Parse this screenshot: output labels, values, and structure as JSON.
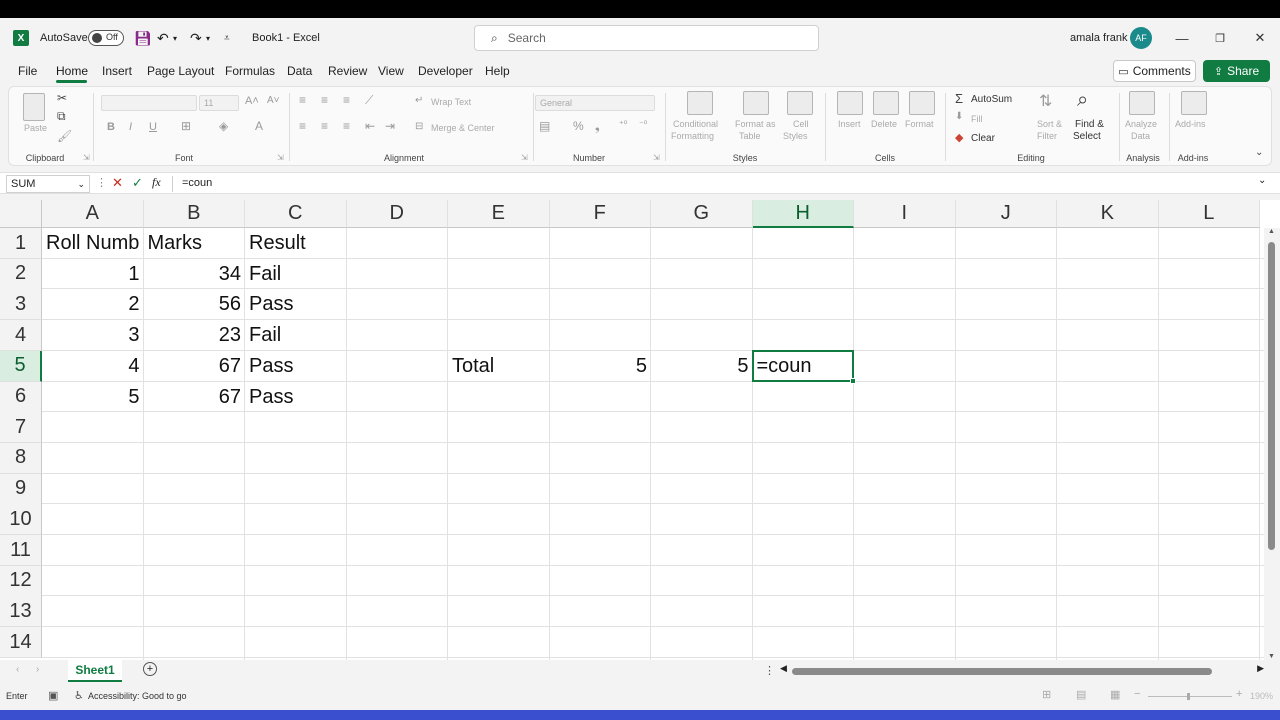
{
  "titlebar": {
    "autosave_label": "AutoSave",
    "autosave_state": "Off",
    "doc_title": "Book1  -  Excel",
    "search_placeholder": "Search",
    "user_name": "amala frank",
    "user_initials": "AF"
  },
  "menu": {
    "tabs": [
      "File",
      "Home",
      "Insert",
      "Page Layout",
      "Formulas",
      "Data",
      "Review",
      "View",
      "Developer",
      "Help"
    ],
    "active_tab": "Home",
    "comments_label": "Comments",
    "share_label": "Share"
  },
  "ribbon": {
    "clipboard": {
      "paste": "Paste",
      "label": "Clipboard"
    },
    "font": {
      "size": "11",
      "bold": "B",
      "italic": "I",
      "underline": "U",
      "label": "Font"
    },
    "alignment": {
      "wrap": "Wrap Text",
      "merge": "Merge & Center",
      "label": "Alignment"
    },
    "number": {
      "format": "General",
      "label": "Number"
    },
    "styles": {
      "cond1": "Conditional",
      "cond2": "Formatting",
      "fmt1": "Format as",
      "fmt2": "Table",
      "cell1": "Cell",
      "cell2": "Styles",
      "label": "Styles"
    },
    "cells": {
      "insert": "Insert",
      "delete": "Delete",
      "format": "Format",
      "label": "Cells"
    },
    "editing": {
      "autosum": "AutoSum",
      "fill": "Fill",
      "clear": "Clear",
      "sort1": "Sort &",
      "sort2": "Filter",
      "find1": "Find &",
      "find2": "Select",
      "label": "Editing"
    },
    "analysis": {
      "a1": "Analyze",
      "a2": "Data",
      "label": "Analysis"
    },
    "addins": {
      "a1": "Add-ins",
      "label": "Add-ins"
    }
  },
  "formula_bar": {
    "name_box": "SUM",
    "cancel_icon": "✕",
    "enter_icon": "✓",
    "fx": "fx",
    "content": "=coun"
  },
  "grid": {
    "columns": [
      "A",
      "B",
      "C",
      "D",
      "E",
      "F",
      "G",
      "H",
      "I",
      "J",
      "K",
      "L"
    ],
    "selected_column": "H",
    "rows": [
      "1",
      "2",
      "3",
      "4",
      "5",
      "6",
      "7",
      "8",
      "9",
      "10",
      "11",
      "12",
      "13",
      "14"
    ],
    "selected_row": "5",
    "cells": {
      "A1": "Roll Numb",
      "B1": "Marks",
      "C1": "Result",
      "A2": "1",
      "B2": "34",
      "C2": "Fail",
      "A3": "2",
      "B3": "56",
      "C3": "Pass",
      "A4": "3",
      "B4": "23",
      "C4": "Fail",
      "A5": "4",
      "B5": "67",
      "C5": "Pass",
      "A6": "5",
      "B6": "67",
      "C6": "Pass",
      "E5": "Total",
      "F5": "5",
      "G5": "5",
      "H5": "=coun"
    }
  },
  "sheets": {
    "tabs": [
      "Sheet1"
    ],
    "active": "Sheet1"
  },
  "status": {
    "mode": "Enter",
    "accessibility": "Accessibility: Good to go",
    "zoom": "190%"
  }
}
